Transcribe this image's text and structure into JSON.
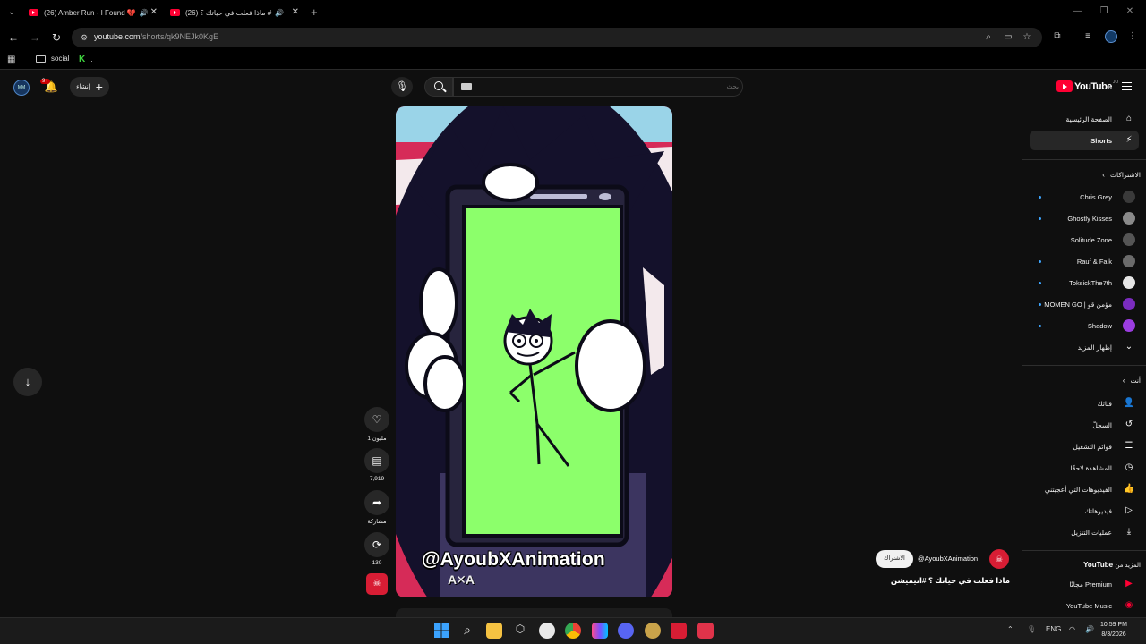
{
  "browser": {
    "tabs": [
      {
        "title": "(26) Amber Run - I Found 💔",
        "active": false
      },
      {
        "title": "(26) ماذا فعلت في حياتك ؟ #",
        "active": true
      }
    ],
    "url_host": "youtube.com",
    "url_path": "/shorts/qk9NEJk0KgE",
    "bookmarks": [
      {
        "label": "social",
        "icon": "folder-icon"
      },
      {
        "label": ".",
        "icon": "k-icon"
      }
    ]
  },
  "header": {
    "notification_count": "9+",
    "create_label": "إنشاء",
    "search_placeholder": "بحث",
    "logo_text": "YouTube",
    "logo_country": "JO",
    "avatar_text": "MM"
  },
  "guide": {
    "home": "الصفحة الرئيسية",
    "shorts": "Shorts",
    "subscriptions_title": "الاشتراكات",
    "subscriptions": [
      {
        "name": "Chris Grey",
        "new": true,
        "color": "#3a3a3a"
      },
      {
        "name": "Ghostly Kisses",
        "new": true,
        "color": "#8a8a8a"
      },
      {
        "name": "Solitude Zone",
        "new": false,
        "color": "#555555"
      },
      {
        "name": "Rauf & Faik",
        "new": true,
        "color": "#6b6b6b"
      },
      {
        "name": "ToksickThe7th",
        "new": true,
        "color": "#e6e6e6"
      },
      {
        "name": "مؤمن قو | MOMEN GO",
        "new": true,
        "color": "#7b2cbf"
      },
      {
        "name": "Shadow",
        "new": true,
        "color": "#9b3de0"
      }
    ],
    "show_more": "إظهار المزيد",
    "you_title": "أنت",
    "you_items": [
      {
        "label": "قناتك",
        "icon": "person-icon",
        "glyph": "👤"
      },
      {
        "label": "السجلّ",
        "icon": "history-icon",
        "glyph": "↺"
      },
      {
        "label": "قوائم التشغيل",
        "icon": "playlist-icon",
        "glyph": "☰"
      },
      {
        "label": "المشاهدة لاحقًا",
        "icon": "clock-icon",
        "glyph": "◷"
      },
      {
        "label": "الفيديوهات التي أعجبتني",
        "icon": "thumbs-up-icon",
        "glyph": "👍"
      },
      {
        "label": "فيديوهاتك",
        "icon": "video-icon",
        "glyph": "▷"
      },
      {
        "label": "عمليات التنزيل",
        "icon": "download-icon",
        "glyph": "⤓"
      }
    ],
    "more_from_prefix": "المزيد من",
    "more_from_brand": "YouTube",
    "more_items": [
      {
        "label": "Premium مجانًا",
        "icon": "yt-premium-icon"
      },
      {
        "label": "YouTube Music",
        "icon": "yt-music-icon"
      }
    ]
  },
  "short": {
    "watermark": "@AyoubXAnimation",
    "watermark_logo": "A✕A",
    "likes": "1 مليون",
    "comments": "7,919",
    "share": "مشاركة",
    "remix": "130",
    "channel_handle": "@AyoubXAnimation",
    "subscribe": "الاشتراك",
    "title": "ماذا فعلت في حياتك ؟ #انيميشن"
  },
  "taskbar": {
    "language": "ENG",
    "time": "10:59 PM",
    "date": "8/3/2026"
  },
  "colors": {
    "background": "#0f0f0f",
    "accent_red": "#ff0033",
    "green_screen": "#8cff6b",
    "video_bg_pink": "#d62b58"
  }
}
